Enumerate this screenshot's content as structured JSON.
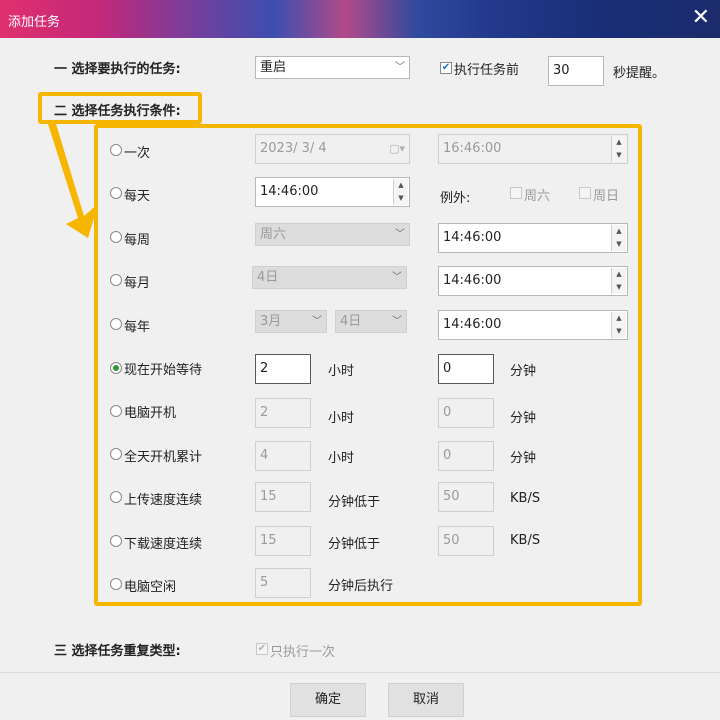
{
  "window": {
    "title": "添加任务",
    "close_icon": "✕"
  },
  "section1": {
    "label": "一  选择要执行的任务:",
    "task_select": "重启",
    "before_check_label": "执行任务前",
    "remind_value": "30",
    "remind_suffix": "秒提醒。"
  },
  "section2": {
    "label": "二  选择任务执行条件:"
  },
  "conditions": {
    "once": {
      "label": "一次",
      "date": "2023/  3/  4",
      "time": "16:46:00"
    },
    "daily": {
      "label": "每天",
      "time": "14:46:00",
      "except_label": "例外:",
      "sat_label": "周六",
      "sun_label": "周日"
    },
    "weekly": {
      "label": "每周",
      "day_select": "周六",
      "time": "14:46:00"
    },
    "monthly": {
      "label": "每月",
      "day_select": "4日",
      "time": "14:46:00"
    },
    "yearly": {
      "label": "每年",
      "month_select": "3月",
      "day_select": "4日",
      "time": "14:46:00"
    },
    "wait_from_now": {
      "label": "现在开始等待",
      "hours": "2",
      "hours_unit": "小时",
      "minutes": "0",
      "minutes_unit": "分钟"
    },
    "power_on": {
      "label": "电脑开机",
      "hours": "2",
      "hours_unit": "小时",
      "minutes": "0",
      "minutes_unit": "分钟"
    },
    "all_day_cumulative": {
      "label": "全天开机累计",
      "hours": "4",
      "hours_unit": "小时",
      "minutes": "0",
      "minutes_unit": "分钟"
    },
    "upload_speed": {
      "label": "上传速度连续",
      "minutes": "15",
      "minutes_unit": "分钟低于",
      "speed": "50",
      "speed_unit": "KB/S"
    },
    "download_speed": {
      "label": "下载速度连续",
      "minutes": "15",
      "minutes_unit": "分钟低于",
      "speed": "50",
      "speed_unit": "KB/S"
    },
    "idle": {
      "label": "电脑空闲",
      "minutes": "5",
      "minutes_unit": "分钟后执行"
    }
  },
  "section3": {
    "label": "三  选择任务重复类型:",
    "once_check_label": "只执行一次"
  },
  "buttons": {
    "ok": "确定",
    "cancel": "取消"
  },
  "colors": {
    "highlight": "#f6b600",
    "radio_selected": "#2f9a2f"
  }
}
